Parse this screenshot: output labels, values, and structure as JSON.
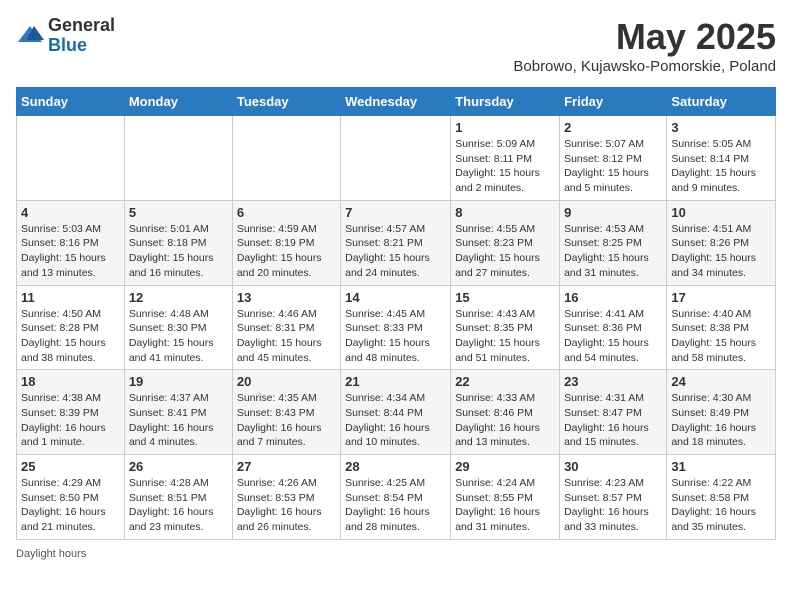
{
  "header": {
    "logo_general": "General",
    "logo_blue": "Blue",
    "month": "May 2025",
    "location": "Bobrowo, Kujawsko-Pomorskie, Poland"
  },
  "days_of_week": [
    "Sunday",
    "Monday",
    "Tuesday",
    "Wednesday",
    "Thursday",
    "Friday",
    "Saturday"
  ],
  "weeks": [
    [
      {
        "day": "",
        "info": ""
      },
      {
        "day": "",
        "info": ""
      },
      {
        "day": "",
        "info": ""
      },
      {
        "day": "",
        "info": ""
      },
      {
        "day": "1",
        "info": "Sunrise: 5:09 AM\nSunset: 8:11 PM\nDaylight: 15 hours and 2 minutes."
      },
      {
        "day": "2",
        "info": "Sunrise: 5:07 AM\nSunset: 8:12 PM\nDaylight: 15 hours and 5 minutes."
      },
      {
        "day": "3",
        "info": "Sunrise: 5:05 AM\nSunset: 8:14 PM\nDaylight: 15 hours and 9 minutes."
      }
    ],
    [
      {
        "day": "4",
        "info": "Sunrise: 5:03 AM\nSunset: 8:16 PM\nDaylight: 15 hours and 13 minutes."
      },
      {
        "day": "5",
        "info": "Sunrise: 5:01 AM\nSunset: 8:18 PM\nDaylight: 15 hours and 16 minutes."
      },
      {
        "day": "6",
        "info": "Sunrise: 4:59 AM\nSunset: 8:19 PM\nDaylight: 15 hours and 20 minutes."
      },
      {
        "day": "7",
        "info": "Sunrise: 4:57 AM\nSunset: 8:21 PM\nDaylight: 15 hours and 24 minutes."
      },
      {
        "day": "8",
        "info": "Sunrise: 4:55 AM\nSunset: 8:23 PM\nDaylight: 15 hours and 27 minutes."
      },
      {
        "day": "9",
        "info": "Sunrise: 4:53 AM\nSunset: 8:25 PM\nDaylight: 15 hours and 31 minutes."
      },
      {
        "day": "10",
        "info": "Sunrise: 4:51 AM\nSunset: 8:26 PM\nDaylight: 15 hours and 34 minutes."
      }
    ],
    [
      {
        "day": "11",
        "info": "Sunrise: 4:50 AM\nSunset: 8:28 PM\nDaylight: 15 hours and 38 minutes."
      },
      {
        "day": "12",
        "info": "Sunrise: 4:48 AM\nSunset: 8:30 PM\nDaylight: 15 hours and 41 minutes."
      },
      {
        "day": "13",
        "info": "Sunrise: 4:46 AM\nSunset: 8:31 PM\nDaylight: 15 hours and 45 minutes."
      },
      {
        "day": "14",
        "info": "Sunrise: 4:45 AM\nSunset: 8:33 PM\nDaylight: 15 hours and 48 minutes."
      },
      {
        "day": "15",
        "info": "Sunrise: 4:43 AM\nSunset: 8:35 PM\nDaylight: 15 hours and 51 minutes."
      },
      {
        "day": "16",
        "info": "Sunrise: 4:41 AM\nSunset: 8:36 PM\nDaylight: 15 hours and 54 minutes."
      },
      {
        "day": "17",
        "info": "Sunrise: 4:40 AM\nSunset: 8:38 PM\nDaylight: 15 hours and 58 minutes."
      }
    ],
    [
      {
        "day": "18",
        "info": "Sunrise: 4:38 AM\nSunset: 8:39 PM\nDaylight: 16 hours and 1 minute."
      },
      {
        "day": "19",
        "info": "Sunrise: 4:37 AM\nSunset: 8:41 PM\nDaylight: 16 hours and 4 minutes."
      },
      {
        "day": "20",
        "info": "Sunrise: 4:35 AM\nSunset: 8:43 PM\nDaylight: 16 hours and 7 minutes."
      },
      {
        "day": "21",
        "info": "Sunrise: 4:34 AM\nSunset: 8:44 PM\nDaylight: 16 hours and 10 minutes."
      },
      {
        "day": "22",
        "info": "Sunrise: 4:33 AM\nSunset: 8:46 PM\nDaylight: 16 hours and 13 minutes."
      },
      {
        "day": "23",
        "info": "Sunrise: 4:31 AM\nSunset: 8:47 PM\nDaylight: 16 hours and 15 minutes."
      },
      {
        "day": "24",
        "info": "Sunrise: 4:30 AM\nSunset: 8:49 PM\nDaylight: 16 hours and 18 minutes."
      }
    ],
    [
      {
        "day": "25",
        "info": "Sunrise: 4:29 AM\nSunset: 8:50 PM\nDaylight: 16 hours and 21 minutes."
      },
      {
        "day": "26",
        "info": "Sunrise: 4:28 AM\nSunset: 8:51 PM\nDaylight: 16 hours and 23 minutes."
      },
      {
        "day": "27",
        "info": "Sunrise: 4:26 AM\nSunset: 8:53 PM\nDaylight: 16 hours and 26 minutes."
      },
      {
        "day": "28",
        "info": "Sunrise: 4:25 AM\nSunset: 8:54 PM\nDaylight: 16 hours and 28 minutes."
      },
      {
        "day": "29",
        "info": "Sunrise: 4:24 AM\nSunset: 8:55 PM\nDaylight: 16 hours and 31 minutes."
      },
      {
        "day": "30",
        "info": "Sunrise: 4:23 AM\nSunset: 8:57 PM\nDaylight: 16 hours and 33 minutes."
      },
      {
        "day": "31",
        "info": "Sunrise: 4:22 AM\nSunset: 8:58 PM\nDaylight: 16 hours and 35 minutes."
      }
    ]
  ],
  "footer": {
    "daylight_label": "Daylight hours"
  }
}
